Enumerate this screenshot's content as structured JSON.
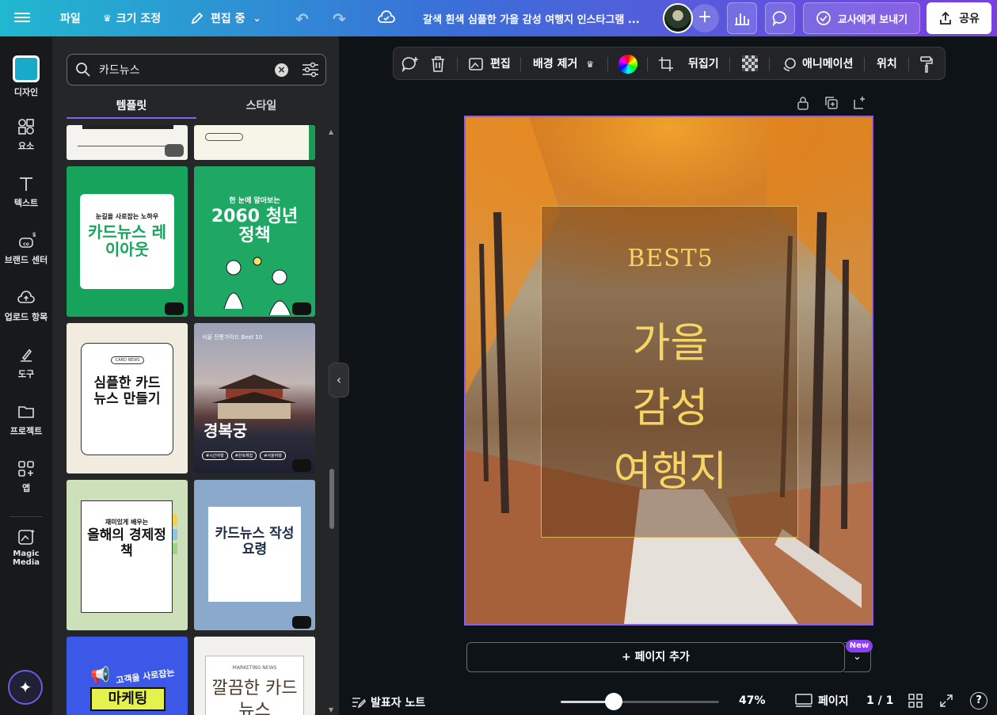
{
  "topbar": {
    "file": "파일",
    "resize": "크기 조정",
    "edit_mode": "편집 중",
    "doc_title": "갈색 흰색 심플한 가을 감성 여행지 인스타그램 ...",
    "send_teacher": "교사에게 보내기",
    "share": "공유"
  },
  "rail": {
    "items": [
      {
        "label": "디자인",
        "icon": "design-icon"
      },
      {
        "label": "요소",
        "icon": "elements-icon"
      },
      {
        "label": "텍스트",
        "icon": "text-icon"
      },
      {
        "label": "브랜드 센터",
        "icon": "brand-icon"
      },
      {
        "label": "업로드 항목",
        "icon": "upload-icon"
      },
      {
        "label": "도구",
        "icon": "tools-icon"
      },
      {
        "label": "프로젝트",
        "icon": "folder-icon"
      },
      {
        "label": "앱",
        "icon": "apps-icon"
      },
      {
        "label": "Magic Media",
        "icon": "magic-media-icon"
      }
    ]
  },
  "panel": {
    "search_value": "카드뉴스",
    "tabs": [
      "템플릿",
      "스타일"
    ],
    "templates": [
      {
        "title": "카드뉴스 레이아웃",
        "subtitle": "눈길을 사로잡는 노하우"
      },
      {
        "title": "2060 청년정책",
        "subtitle": "한 눈에 알아보는"
      },
      {
        "title": "심플한 카드뉴스 만들기",
        "badge": "CARD NEWS"
      },
      {
        "title": "경복궁",
        "subtitle": "서울 전통가이드 Best 10",
        "tags": [
          "#시간여행",
          "#한복체험",
          "#서울여행"
        ]
      },
      {
        "title": "올해의 경제정책",
        "subtitle": "재미있게 배우는"
      },
      {
        "title": "카드뉴스 작성요령"
      },
      {
        "title": "마케팅",
        "subtitle": "고객을 사로잡는"
      },
      {
        "title": "깔끔한 카드뉴스",
        "subtitle": "MARKETING NEWS"
      }
    ]
  },
  "canvas_toolbar": {
    "edit": "편집",
    "bg_remove": "배경 제거",
    "flip": "뒤집기",
    "animation": "애니메이션",
    "position": "위치"
  },
  "design": {
    "best": "BEST5",
    "line1": "가을",
    "line2": "감성",
    "line3": "여행지"
  },
  "add_page": "+ 페이지 추가",
  "new_badge": "New",
  "footer": {
    "notes": "발표자 노트",
    "zoom_percent": 47,
    "zoom": "47%",
    "pages_label": "페이지",
    "page_count": "1 / 1"
  }
}
